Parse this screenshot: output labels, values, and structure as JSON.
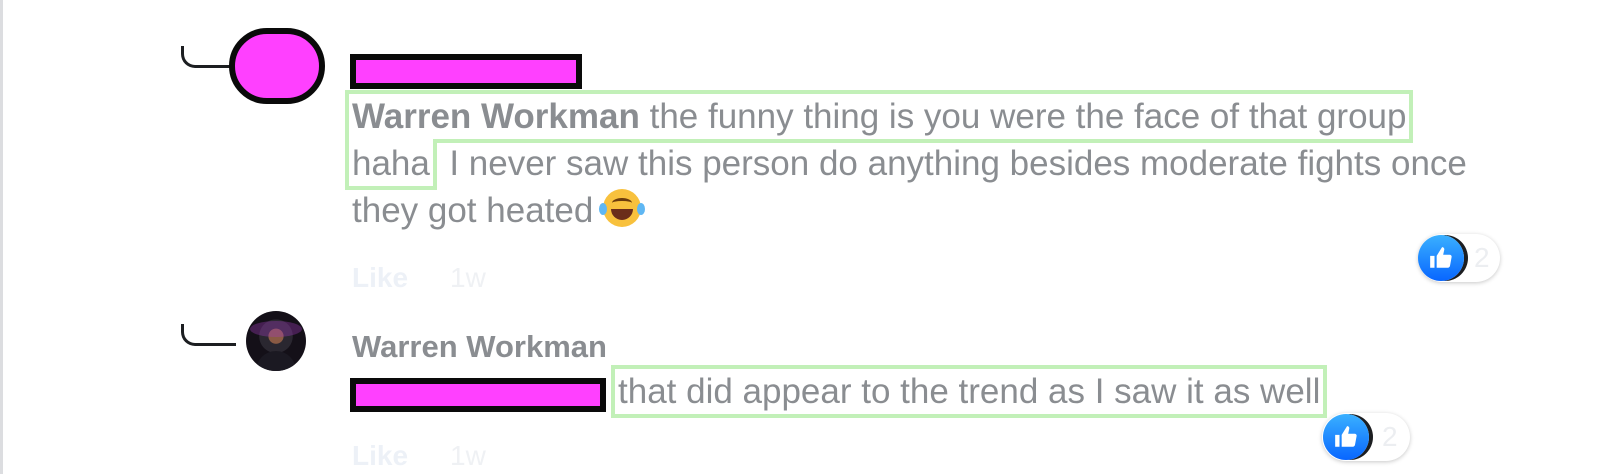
{
  "comments": [
    {
      "author_redacted": true,
      "mention": "Warren Workman",
      "text_highlighted": "the funny thing is you were the face of that group haha",
      "text_rest": ". I never saw this person do anything besides moderate fights once they got heated",
      "emoji": "face-with-tears-of-joy",
      "like_label": "Like",
      "timestamp": "1w",
      "reaction": {
        "icon": "thumbs-up-icon",
        "count": "2"
      }
    },
    {
      "author": "Warren Workman",
      "mention_redacted": true,
      "text_highlighted": "that did appear to the trend as I saw it as well",
      "text_rest": ".",
      "like_label": "Like",
      "timestamp": "1w",
      "reaction": {
        "icon": "thumbs-up-icon",
        "count": "2"
      }
    }
  ],
  "colors": {
    "redaction_fill": "#ff40ff",
    "highlight_outline": "#c2f0b8",
    "like_blue": "#0866ff"
  }
}
